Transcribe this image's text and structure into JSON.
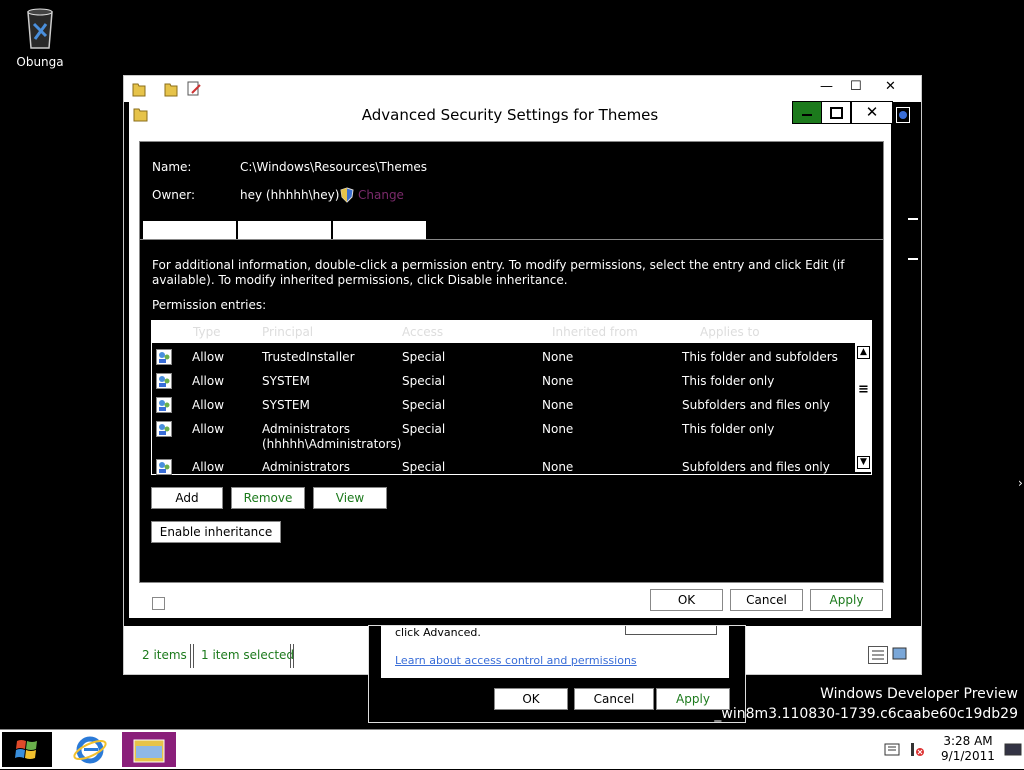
{
  "desktop": {
    "recycle_label": "Obunga"
  },
  "watermark": {
    "line1": "Windows Developer Preview",
    "line2": "_win8m3.110830-1739.c6caabe60c19db29"
  },
  "explorer": {
    "min": "—",
    "max": "☐",
    "close": "✕",
    "status_items": "2 items",
    "status_selected": "1 item selected"
  },
  "properties": {
    "text": "click Advanced.",
    "link": "Learn about access control and permissions",
    "ok": "OK",
    "cancel": "Cancel",
    "apply": "Apply"
  },
  "dialog": {
    "title": "Advanced Security Settings for Themes",
    "close": "✕",
    "name_label": "Name:",
    "name_value": "C:\\Windows\\Resources\\Themes",
    "owner_label": "Owner:",
    "owner_value": "hey (hhhhh\\hey)",
    "change_link": "Change",
    "info_text": "For additional information, double-click a permission entry. To modify permissions, select the entry and click Edit (if available). To modify inherited permissions, click Disable inheritance.",
    "entries_label": "Permission entries:",
    "columns": [
      "Type",
      "Principal",
      "Access",
      "Inherited from",
      "Applies to"
    ],
    "rows": [
      {
        "type": "Allow",
        "principal": "TrustedInstaller",
        "access": "Special",
        "inherited": "None",
        "applies": "This folder and subfolders"
      },
      {
        "type": "Allow",
        "principal": "SYSTEM",
        "access": "Special",
        "inherited": "None",
        "applies": "This folder only"
      },
      {
        "type": "Allow",
        "principal": "SYSTEM",
        "access": "Special",
        "inherited": "None",
        "applies": "Subfolders and files only"
      },
      {
        "type": "Allow",
        "principal": "Administrators (hhhhh\\Administrators)",
        "access": "Special",
        "inherited": "None",
        "applies": "This folder only"
      },
      {
        "type": "Allow",
        "principal": "Administrators",
        "access": "Special",
        "inherited": "None",
        "applies": "Subfolders and files only"
      }
    ],
    "add": "Add",
    "remove": "Remove",
    "view": "View",
    "enable_inheritance": "Enable inheritance",
    "ok": "OK",
    "cancel": "Cancel",
    "apply": "Apply"
  },
  "taskbar": {
    "time": "3:28 AM",
    "date": "9/1/2011"
  },
  "colors": {
    "accent_green": "#1c7a1c",
    "taskbar_explorer": "#8a1f7a",
    "link": "#3a6ed8"
  }
}
